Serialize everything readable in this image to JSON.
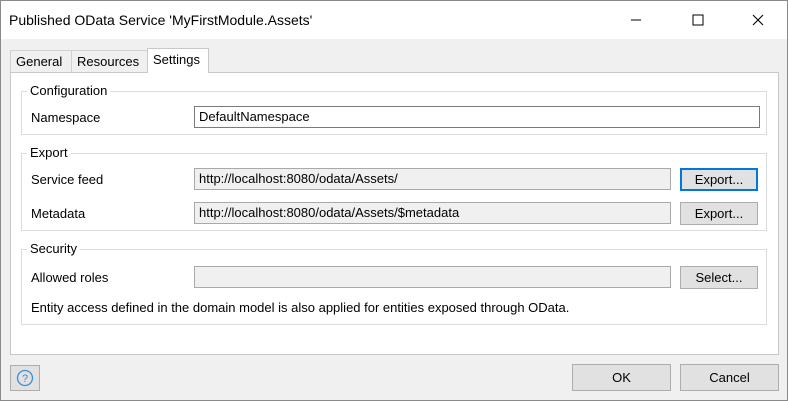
{
  "window": {
    "title": "Published OData Service 'MyFirstModule.Assets'",
    "minimize_icon": "minimize-icon",
    "maximize_icon": "maximize-icon",
    "close_icon": "close-icon"
  },
  "tabs": [
    {
      "label": "General"
    },
    {
      "label": "Resources"
    },
    {
      "label": "Settings",
      "selected": true
    }
  ],
  "configuration": {
    "legend": "Configuration",
    "namespace_label": "Namespace",
    "namespace_value": "DefaultNamespace"
  },
  "export": {
    "legend": "Export",
    "service_feed_label": "Service feed",
    "service_feed_value": "http://localhost:8080/odata/Assets/",
    "service_feed_button": "Export...",
    "metadata_label": "Metadata",
    "metadata_value": "http://localhost:8080/odata/Assets/$metadata",
    "metadata_button": "Export..."
  },
  "security": {
    "legend": "Security",
    "allowed_roles_label": "Allowed roles",
    "allowed_roles_value": "",
    "select_button": "Select...",
    "note": "Entity access defined in the domain model is also applied for entities exposed through OData."
  },
  "footer": {
    "help_icon": "help-icon",
    "ok_label": "OK",
    "cancel_label": "Cancel"
  },
  "colors": {
    "focus_accent": "#0078d7",
    "help_icon_blue": "#3a8ed8"
  }
}
